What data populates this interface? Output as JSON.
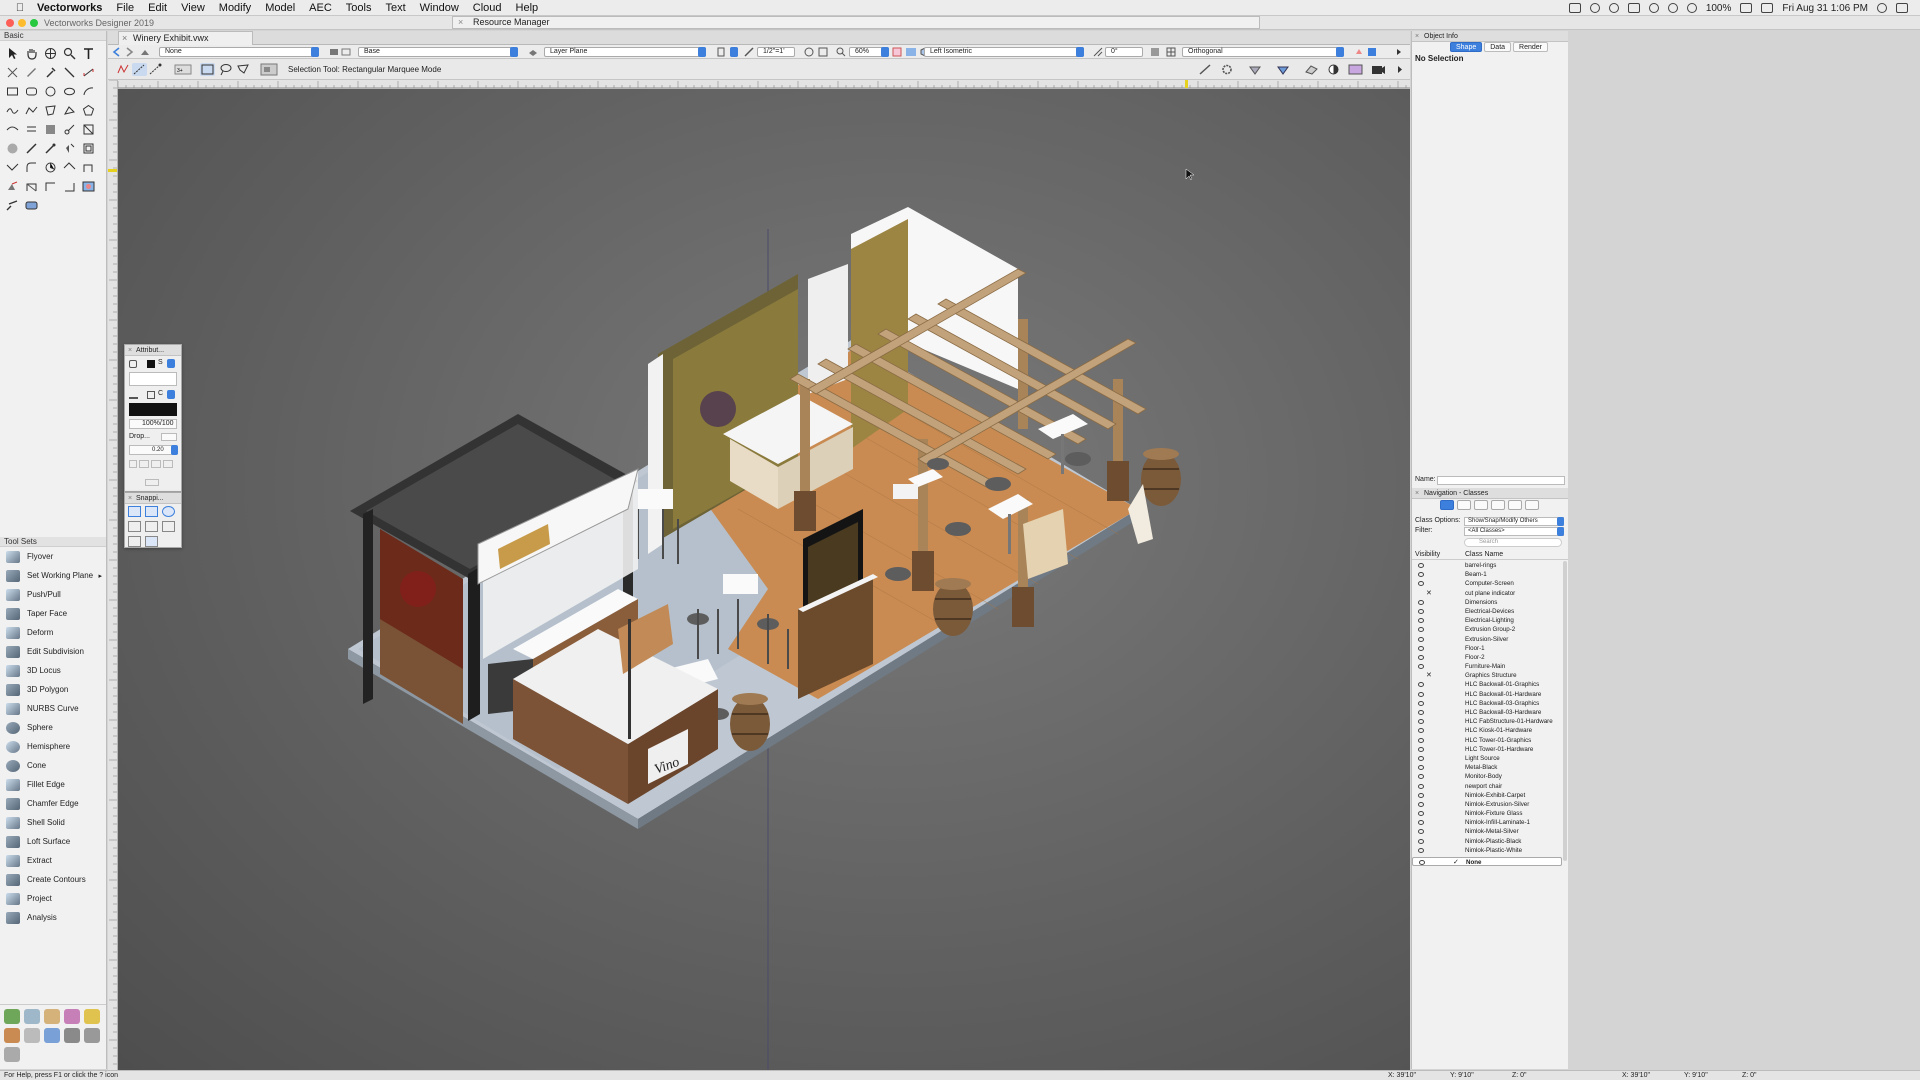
{
  "menubar": {
    "app": "Vectorworks",
    "menus": [
      "File",
      "Edit",
      "View",
      "Modify",
      "Model",
      "AEC",
      "Tools",
      "Text",
      "Window",
      "Cloud",
      "Help"
    ],
    "battery": "100%",
    "datetime": "Fri Aug 31  1:06 PM"
  },
  "app_title": "Vectorworks Designer 2019",
  "resource_manager": "Resource Manager",
  "document_tab": "Winery Exhibit.vwx",
  "viewbar": {
    "active_class": "None",
    "design_layer": "Base",
    "plane": "Layer Plane",
    "scale": "1/2\"=1'",
    "zoom": "60%",
    "view": "Left Isometric",
    "rotation": "0°",
    "projection": "Orthogonal"
  },
  "toolbar": {
    "mode_text": "Selection Tool: Rectangular Marquee Mode"
  },
  "left_palette": {
    "basic_title": "Basic",
    "toolsets_title": "Tool Sets",
    "toolsets": [
      {
        "label": "Flyover",
        "icon": "flyover-icon"
      },
      {
        "label": "Set Working Plane",
        "icon": "working-plane-icon"
      },
      {
        "label": "Push/Pull",
        "icon": "push-pull-icon"
      },
      {
        "label": "Taper Face",
        "icon": "taper-face-icon"
      },
      {
        "label": "Deform",
        "icon": "deform-icon"
      },
      {
        "label": "Edit Subdivision",
        "icon": "subdivision-icon"
      },
      {
        "label": "3D Locus",
        "icon": "locus-icon"
      },
      {
        "label": "3D Polygon",
        "icon": "polygon-3d-icon"
      },
      {
        "label": "NURBS Curve",
        "icon": "nurbs-icon"
      },
      {
        "label": "Sphere",
        "icon": "sphere-icon"
      },
      {
        "label": "Hemisphere",
        "icon": "hemisphere-icon"
      },
      {
        "label": "Cone",
        "icon": "cone-icon"
      },
      {
        "label": "Fillet Edge",
        "icon": "fillet-icon"
      },
      {
        "label": "Chamfer Edge",
        "icon": "chamfer-icon"
      },
      {
        "label": "Shell Solid",
        "icon": "shell-icon"
      },
      {
        "label": "Loft Surface",
        "icon": "loft-icon"
      },
      {
        "label": "Extract",
        "icon": "extract-icon"
      },
      {
        "label": "Create Contours",
        "icon": "contours-icon"
      },
      {
        "label": "Project",
        "icon": "project-icon"
      },
      {
        "label": "Analysis",
        "icon": "analysis-icon"
      }
    ]
  },
  "attributes_palette": {
    "title": "Attribut...",
    "fill_style": "S",
    "pen_style": "C",
    "opacity": "100%/100",
    "drop_label": "Drop...",
    "line_weight": "0.20"
  },
  "snapping_palette": {
    "title": "Snappi..."
  },
  "object_info": {
    "title": "Object Info",
    "tabs": [
      "Shape",
      "Data",
      "Render"
    ],
    "active_tab": "Shape",
    "selection": "No Selection",
    "name_label": "Name:"
  },
  "navigation": {
    "title": "Navigation - Classes",
    "class_options_label": "Class Options:",
    "class_options_value": "Show/Snap/Modify Others",
    "filter_label": "Filter:",
    "filter_value": "<All Classes>",
    "search_placeholder": "Search",
    "col_visibility": "Visibility",
    "col_class_name": "Class Name",
    "classes": [
      {
        "name": "barrel-rings",
        "vis": "visible"
      },
      {
        "name": "Beam-1",
        "vis": "visible"
      },
      {
        "name": "Computer-Screen",
        "vis": "visible"
      },
      {
        "name": "cut plane indicator",
        "vis": "invisible"
      },
      {
        "name": "Dimensions",
        "vis": "visible"
      },
      {
        "name": "Electrical-Devices",
        "vis": "visible"
      },
      {
        "name": "Electrical-Lighting",
        "vis": "visible"
      },
      {
        "name": "Extrusion Group-2",
        "vis": "visible"
      },
      {
        "name": "Extrusion-Silver",
        "vis": "visible"
      },
      {
        "name": "Floor-1",
        "vis": "visible"
      },
      {
        "name": "Floor-2",
        "vis": "visible"
      },
      {
        "name": "Furniture-Main",
        "vis": "visible"
      },
      {
        "name": "Graphics Structure",
        "vis": "invisible"
      },
      {
        "name": "HLC Backwall-01-Graphics",
        "vis": "visible"
      },
      {
        "name": "HLC Backwall-01-Hardware",
        "vis": "visible"
      },
      {
        "name": "HLC Backwall-03-Graphics",
        "vis": "visible"
      },
      {
        "name": "HLC Backwall-03-Hardware",
        "vis": "visible"
      },
      {
        "name": "HLC FabStructure-01-Hardware",
        "vis": "visible"
      },
      {
        "name": "HLC Kiosk-01-Hardware",
        "vis": "visible"
      },
      {
        "name": "HLC Tower-01-Graphics",
        "vis": "visible"
      },
      {
        "name": "HLC Tower-01-Hardware",
        "vis": "visible"
      },
      {
        "name": "Light Source",
        "vis": "visible"
      },
      {
        "name": "Metal-Black",
        "vis": "visible"
      },
      {
        "name": "Monitor-Body",
        "vis": "visible"
      },
      {
        "name": "newport chair",
        "vis": "visible"
      },
      {
        "name": "Nimlok-Exhibit-Carpet",
        "vis": "visible"
      },
      {
        "name": "Nimlok-Extrusion-Silver",
        "vis": "visible"
      },
      {
        "name": "Nimlok-Fixture Glass",
        "vis": "visible"
      },
      {
        "name": "Nimlok-Infill-Laminate-1",
        "vis": "visible"
      },
      {
        "name": "Nimlok-Metal-Silver",
        "vis": "visible"
      },
      {
        "name": "Nimlok-Plastic-Black",
        "vis": "visible"
      },
      {
        "name": "Nimlok-Plastic-White",
        "vis": "visible"
      },
      {
        "name": "None",
        "vis": "visible",
        "active": true
      }
    ]
  },
  "model": {
    "sign_text": "Vino"
  },
  "statusbar": {
    "help": "For Help, press F1 or click the ? icon",
    "coords": [
      "X: 39'10\"",
      "Y: 9'10\"",
      "Z: 0\"",
      "X: 39'10\"",
      "Y: 9'10\"",
      "Z: 0\""
    ]
  },
  "colors": {
    "accent": "#3d7fdc",
    "canvas": "#666666",
    "wood": "#c98b52",
    "carpet": "#b4c0cc"
  }
}
